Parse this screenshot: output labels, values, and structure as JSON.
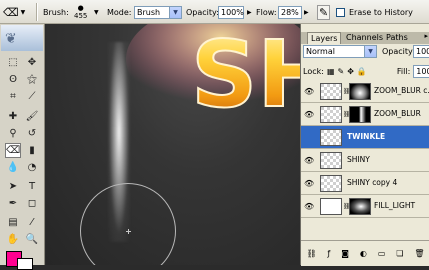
{
  "options_bar": {
    "brush_label": "Brush:",
    "brush_size": "455",
    "mode_label": "Mode:",
    "mode_value": "Brush",
    "opacity_label": "Opacity:",
    "opacity_value": "100%",
    "flow_label": "Flow:",
    "flow_value": "28%",
    "erase_to_history_label": "Erase to History",
    "erase_to_history_checked": false
  },
  "canvas": {
    "text_fragment": "SH"
  },
  "layers_panel": {
    "tabs": [
      {
        "label": "Layers",
        "active": true
      },
      {
        "label": "Channels",
        "active": false
      },
      {
        "label": "Paths",
        "active": false
      }
    ],
    "blend_mode": "Normal",
    "opacity_label": "Opacity:",
    "opacity_value": "100",
    "lock_label": "Lock:",
    "fill_label": "Fill:",
    "fill_value": "100",
    "layers": [
      {
        "name": "ZOOM_BLUR c...",
        "visible": true,
        "has_mask": true,
        "selected": false
      },
      {
        "name": "ZOOM_BLUR",
        "visible": true,
        "has_mask": true,
        "selected": false
      },
      {
        "name": "TWINKLE",
        "visible": false,
        "has_mask": false,
        "selected": true
      },
      {
        "name": "SHINY",
        "visible": true,
        "has_mask": false,
        "selected": false
      },
      {
        "name": "SHINY copy 4",
        "visible": true,
        "has_mask": false,
        "selected": false
      },
      {
        "name": "FILL_LIGHT",
        "visible": true,
        "has_mask": true,
        "selected": false
      }
    ]
  },
  "colors": {
    "foreground": "#ff0090",
    "background": "#ffffff",
    "selected_layer": "#316ac5"
  }
}
